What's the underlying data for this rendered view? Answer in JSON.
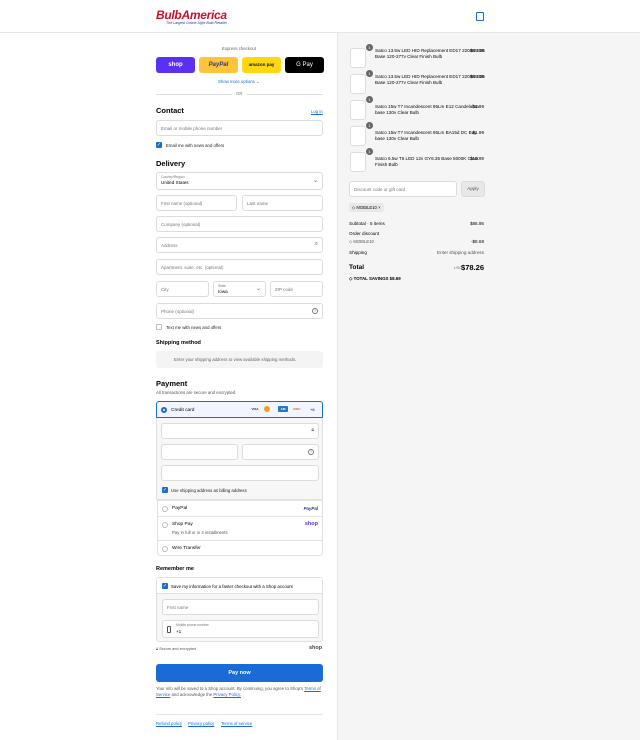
{
  "header": {
    "brand": "BulbAmerica",
    "tagline": "The Largest Online Light Bulb Retailer"
  },
  "express": {
    "title": "Express checkout",
    "shop": "shop",
    "paypal": "PayPal",
    "amazon": "amazon pay",
    "gpay": "G Pay",
    "more": "Show more options",
    "or": "OR"
  },
  "contact": {
    "title": "Contact",
    "login": "Log in",
    "input_placeholder": "Email or mobile phone number",
    "news": "Email me with news and offers"
  },
  "delivery": {
    "title": "Delivery",
    "country_label": "Country/Region",
    "country": "United States",
    "first": "First name (optional)",
    "last": "Last name",
    "company": "Company (optional)",
    "address": "Address",
    "apt": "Apartment, suite, etc. (optional)",
    "city": "City",
    "state_label": "State",
    "state": "Iowa",
    "zip": "ZIP code",
    "phone": "Phone (optional)",
    "text_news": "Text me with news and offers"
  },
  "shipping": {
    "title": "Shipping method",
    "note": "Enter your shipping address to view available shipping methods."
  },
  "payment": {
    "title": "Payment",
    "subtitle": "All transactions are secure and encrypted.",
    "credit": "Credit card",
    "card_more": "+6",
    "billing": "Use shipping address as billing address",
    "paypal": "PayPal",
    "paypal_logo": "PayPal",
    "shoppay": "Shop Pay",
    "shoppay_sub": "Pay in full or in 4 installments",
    "shoppay_logo": "shop",
    "wire": "Wire Transfer"
  },
  "remember": {
    "title": "Remember me",
    "save": "Save my information for a faster checkout with a Shop account",
    "first": "First name",
    "phone_label": "Mobile phone number",
    "phone": "+1",
    "secure": "Secure and encrypted",
    "shop": "shop"
  },
  "pay_button": "Pay now",
  "legal": {
    "prefix": "Your info will be saved to a Shop account. By continuing, you agree to Shop's",
    "terms": "Terms of Service",
    "and": "and acknowledge the",
    "privacy": "Privacy Policy."
  },
  "footer": {
    "refund": "Refund policy",
    "privacy": "Privacy policy",
    "terms": "Terms of service"
  },
  "items": [
    {
      "qty": "1",
      "name": "Satco 13.5w LED HID Replacement ED17 2200K E26 Base 120-277v Clear Finish Bulb",
      "price": "$35.99"
    },
    {
      "qty": "1",
      "name": "Satco 13.5w LED HID Replacement ED17 2200K E26 Base 120-277v Clear Finish Bulb",
      "price": "$35.99"
    },
    {
      "qty": "1",
      "name": "Satco 15w T7 Incandescent 95Lm E12 Candelabra base 130v Clear Bulb",
      "price": "$1.99"
    },
    {
      "qty": "1",
      "name": "Satco 15w T7 Incandescent 95Lm BA15d DC Bay base 130v Clear Bulb",
      "price": "$1.99"
    },
    {
      "qty": "1",
      "name": "Satco 6.5w T6 LED 12v GY6.35 Base 5000K Clear Finish Bulb",
      "price": "$10.99"
    }
  ],
  "discount": {
    "placeholder": "Discount code or gift card",
    "apply": "Apply",
    "code": "MOBILE10"
  },
  "summary": {
    "subtotal_label": "Subtotal · 5 items",
    "subtotal": "$86.95",
    "order_discount": "Order discount",
    "code": "MOBILE10",
    "code_amount": "-$8.69",
    "shipping_label": "Shipping",
    "shipping": "Enter shipping address",
    "total_label": "Total",
    "currency": "USD",
    "total": "$78.26",
    "savings_label": "TOTAL SAVINGS",
    "savings": "$8.69"
  }
}
